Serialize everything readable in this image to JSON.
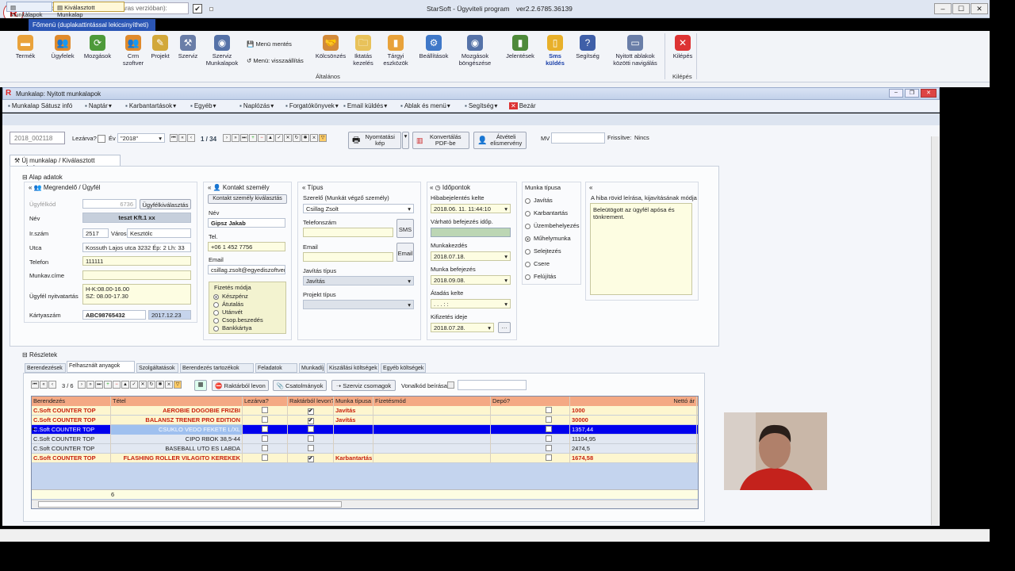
{
  "titlebar": {
    "warehouse_placeholder": "Válasszon raktárat(csak többraktáras verzióban):",
    "title": "StarSoft - Ügyviteli program",
    "version": "ver2.2.6785.36139"
  },
  "ribbon_tab": "Főmenü (duplakattintással lekicsinyítheti)",
  "ribbon": {
    "items": [
      {
        "label": "Termék",
        "icon": "box-icon",
        "color": "#e9a23b"
      },
      {
        "label": "Ügyfelek",
        "icon": "people-icon",
        "color": "#e08a2c"
      },
      {
        "label": "Mozgások",
        "icon": "cycle-icon",
        "color": "#4e9a3a"
      },
      {
        "label": "Crm szoftver",
        "icon": "crm-icon",
        "color": "#e08a2c"
      },
      {
        "label": "Projekt",
        "icon": "pencil-icon",
        "color": "#d2a83a"
      },
      {
        "label": "Szerviz",
        "icon": "tools-icon",
        "color": "#6a7ea8"
      },
      {
        "label": "Szerviz Munkalapok",
        "icon": "eye-icon",
        "color": "#5572a8"
      },
      {
        "label": "Kölcsönzés",
        "icon": "handshake-icon",
        "color": "#d28a3a"
      },
      {
        "label": "Iktatás kezelés",
        "icon": "folder-icon",
        "color": "#e8c25a"
      },
      {
        "label": "Tárgyi eszközök",
        "icon": "asset-icon",
        "color": "#e8a23a"
      },
      {
        "label": "Beállítások",
        "icon": "gear-icon",
        "color": "#3f78c8"
      },
      {
        "label": "Mozgások böngészése",
        "icon": "eye-icon",
        "color": "#5572a8"
      },
      {
        "label": "Jelentések",
        "icon": "chart-icon",
        "color": "#4e8a3a"
      },
      {
        "label": "Sms küldés",
        "icon": "phone-icon",
        "color": "#e8b02a"
      },
      {
        "label": "Segítség",
        "icon": "help-icon",
        "color": "#3f5fa8"
      },
      {
        "label": "Nyitott ablakok közötti navigálás",
        "icon": "windows-icon",
        "color": "#6a7ea8"
      },
      {
        "label": "Kilépés",
        "icon": "close-icon",
        "color": "#d33"
      }
    ],
    "menu_edit": "Menü mentés",
    "menu_reset": "Menü: visszaállítás",
    "group_general": "Általános",
    "group_exit": "Kilépés"
  },
  "child_window_title": "Munkalap: Nyitott munkalapok",
  "menubar": [
    "Munkalap Sátusz infó",
    "Naptár",
    "Karbantartások",
    "Egyéb",
    "Naplózás",
    "Forgatókönyvek",
    "Email küldés",
    "Ablak és menü",
    "Segítség",
    "Bezár"
  ],
  "tabs": [
    "Munkalapok",
    "Kiválasztott Munkalap"
  ],
  "toolbar": {
    "doc_number": "2018_002118",
    "closed_label": "Lezárva?",
    "year_label": "Év",
    "year_value": "\"2018\"",
    "page": "1 / 34",
    "print_btn": "Nyomtatási kép",
    "pdf_btn": "Konvertálás PDF-be",
    "receipt_btn": "Átvételi elismervény",
    "mv_label": "MV",
    "refresh_label": "Frissítve:",
    "refresh_value": "Nincs"
  },
  "sub_tab": "Új munkalap / Kiválasztott munkalap",
  "basic_data": "Alap adatok",
  "customer": {
    "header": "Megrendelő / Ügyfél",
    "code_label": "Ügyfélkód",
    "code_value": "6736",
    "select_btn": "Ügyfélkiválasztás",
    "name_label": "Név",
    "name_value": "teszt Kft.1 xx",
    "zip_label": "Ir.szám",
    "zip_value": "2517",
    "city_label": "Város",
    "city_value": "Kesztölc",
    "street_label": "Utca",
    "street_value": "Kossuth Lajos utca 3232 Ép: 2 Lh: 33",
    "phone_label": "Telefon",
    "phone_value": "111111",
    "site_label": "Munkav.címe",
    "site_value": "",
    "hours_label": "Ügyfél nyitvatartás",
    "hours_line1": "H-K:08.00-16.00",
    "hours_line2": "SZ: 08.00-17.30",
    "card_label": "Kártyaszám",
    "card_value": "ABC98765432",
    "card_date": "2017.12.23"
  },
  "contact": {
    "header": "Kontakt személy",
    "select_btn": "Kontakt személy kiválasztás",
    "name_label": "Név",
    "name_value": "Gipsz Jakab",
    "phone_label": "Tel.",
    "phone_value": "+06 1 452 7756",
    "email_label": "Email",
    "email_value": "csillag.zsolt@egyediszoftverek",
    "payment_header": "Fizetés módja",
    "payment_options": [
      "Készpénz",
      "Átutalás",
      "Utánvét",
      "Csop.beszedés",
      "Bankkártya"
    ],
    "payment_selected": 0
  },
  "type": {
    "header": "Típus",
    "mechanic_label": "Szerelő (Munkát végző személy)",
    "mechanic_value": "Csillag Zsolt",
    "phone_label": "Telefonszám",
    "sms_btn": "SMS",
    "email_label": "Email",
    "email_btn": "Email",
    "repair_type_label": "Javítás típus",
    "repair_type_value": "Javítás",
    "project_type_label": "Projekt típus",
    "project_type_value": ""
  },
  "dates": {
    "header": "Időpontok",
    "report_label": "Hibabejelentés kelte",
    "report_value": "2018.06. 11. 11:44:10",
    "expected_label": "Várható befejezés időp.",
    "start_label": "Munkakezdés",
    "start_value": "2018.07.18.",
    "end_label": "Munka befejezés",
    "end_value": "2018.09.08.",
    "handover_label": "Átadás kelte",
    "handover_value": ". . . : :",
    "payment_label": "Kifizetés ideje",
    "payment_value": "2018.07.28."
  },
  "work_type": {
    "header": "Munka típusa",
    "options": [
      "Javítás",
      "Karbantartás",
      "Üzembehelyezés",
      "Műhelymunka",
      "Selejtezés",
      "Csere",
      "Felújítás"
    ],
    "selected": 3
  },
  "fault": {
    "header": "A hiba rövid leírása, kijavításának módja",
    "text": "Beleütögott az ügyfél apósa és tönkrement."
  },
  "details": "Részletek",
  "detail_tabs": [
    "Berendezések",
    "Felhasznált anyagok",
    "Szolgáltatások",
    "Berendezés tartozékok",
    "Feladatok",
    "Munkadíj",
    "Kiszállási költségek",
    "Egyéb költségek"
  ],
  "grid_toolbar": {
    "page": "3 / 6",
    "stock_out_btn": "Raktárból levon",
    "attachments_btn": "Csatolmányok",
    "service_pkg_btn": "Szerviz csomagok",
    "barcode_label": "Vonalkód beírása"
  },
  "grid": {
    "columns": [
      "Berendezés",
      "Tétel",
      "Lezárva?",
      "Raktárból levon?",
      "Munka típusa",
      "Fizetésmód",
      "Depó?",
      "Nettó ár"
    ],
    "rows": [
      {
        "equip": "C.Soft COUNTER TOP",
        "item": "AEROBIE DOGOBIE FRIZBI",
        "closed": false,
        "stock": true,
        "work": "Javítás",
        "price": "1000",
        "style": "bold"
      },
      {
        "equip": "C.Soft COUNTER TOP",
        "item": "BALANSZ TRENER PRO EDITION",
        "closed": false,
        "stock": true,
        "work": "Javítás",
        "price": "30000",
        "style": "bold"
      },
      {
        "equip": "C.Soft COUNTER TOP",
        "item": "CSUKLO VEDO FEKETE L/XL",
        "closed": false,
        "stock": false,
        "work": "",
        "price": "1357,44",
        "style": "selected"
      },
      {
        "equip": "C.Soft COUNTER TOP",
        "item": "CIPO RBOK 38,5-44",
        "closed": false,
        "stock": false,
        "work": "",
        "price": "11104,95",
        "style": "normal"
      },
      {
        "equip": "C.Soft COUNTER TOP",
        "item": "BASEBALL UTO ES LABDA",
        "closed": false,
        "stock": false,
        "work": "",
        "price": "2474,5",
        "style": "normal"
      },
      {
        "equip": "C.Soft COUNTER TOP",
        "item": "FLASHING ROLLER VILAGITO KEREKEK",
        "closed": false,
        "stock": true,
        "work": "Karbantartás",
        "price": "1674,58",
        "style": "bold"
      }
    ],
    "footer_count": "6"
  }
}
